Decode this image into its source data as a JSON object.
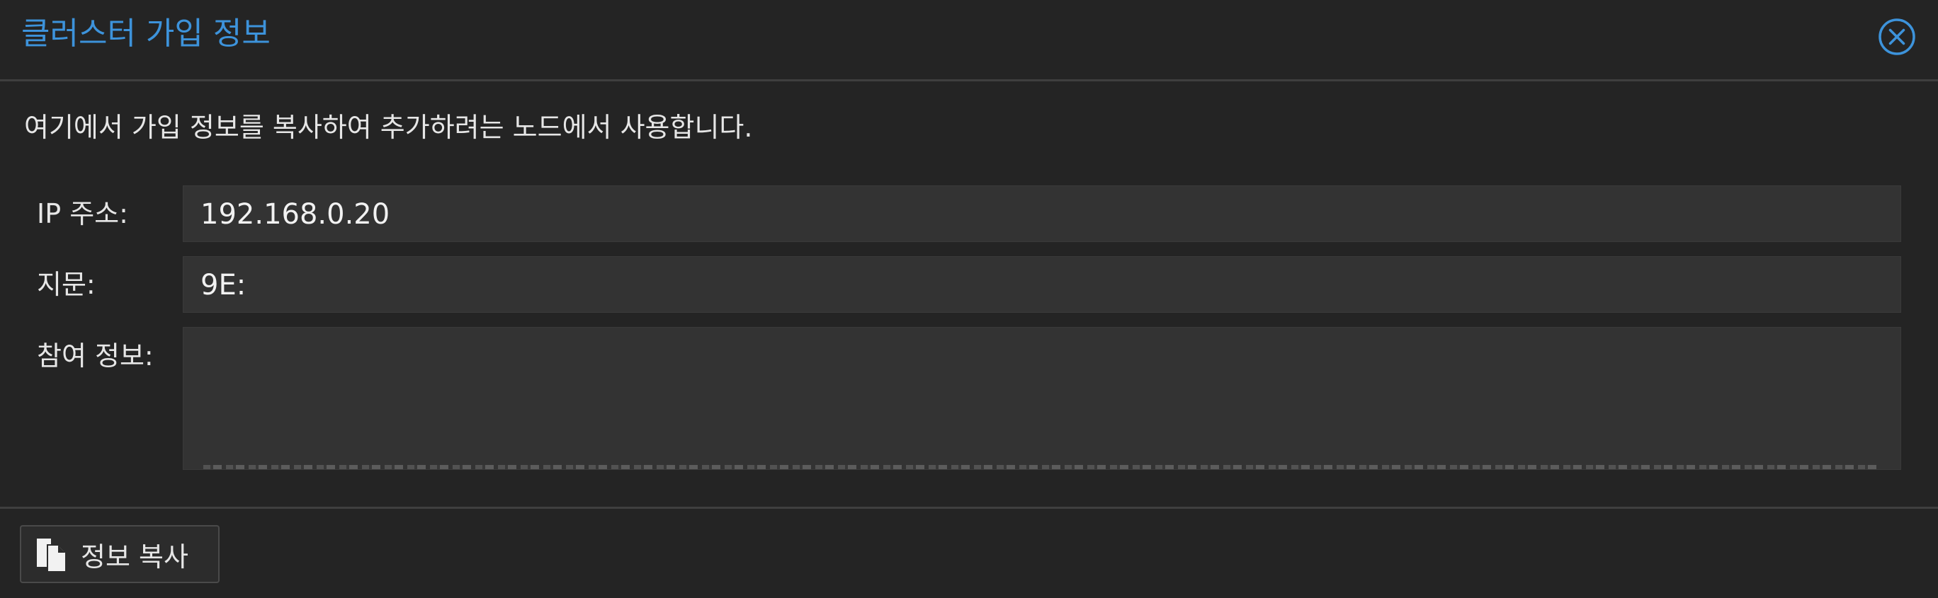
{
  "dialog": {
    "title": "클러스터 가입 정보",
    "description": "여기에서 가입 정보를 복사하여 추가하려는 노드에서 사용합니다."
  },
  "form": {
    "ip_label": "IP 주소:",
    "ip_value": "192.168.0.20",
    "fingerprint_label": "지문:",
    "fingerprint_value": "9E:",
    "join_info_label": "참여 정보:",
    "join_info_value": ""
  },
  "footer": {
    "copy_button_label": "정보 복사"
  },
  "icons": {
    "close": "close-icon",
    "copy": "copy-icon"
  },
  "colors": {
    "accent": "#3d93db",
    "background": "#242424",
    "field_bg": "#333333"
  }
}
